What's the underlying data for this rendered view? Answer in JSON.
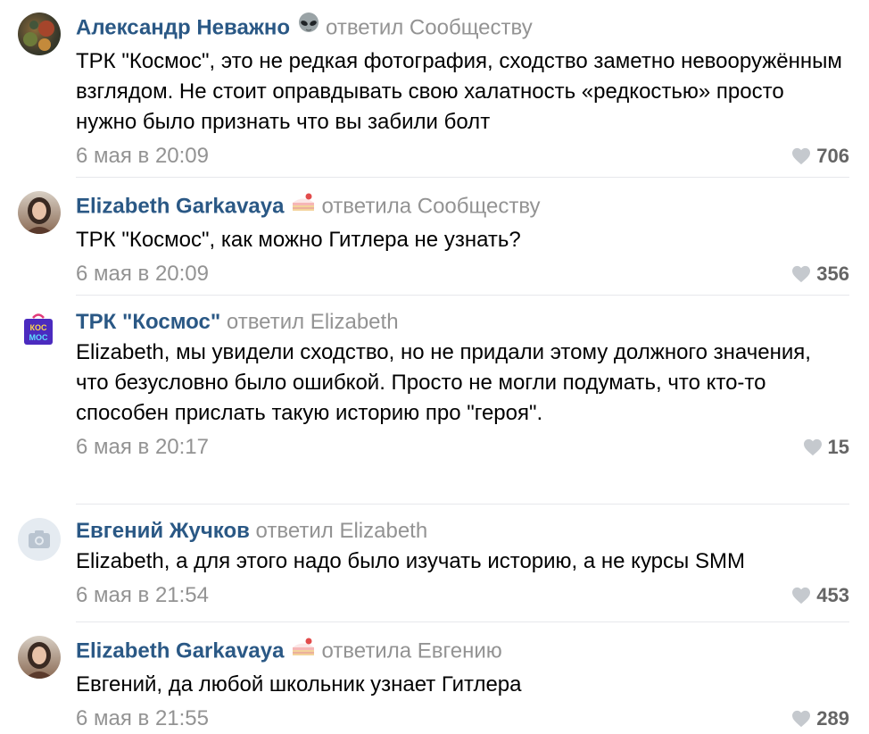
{
  "comments": [
    {
      "author": "Александр Неважно",
      "emoji": "alien-icon",
      "action": "ответил Сообществу",
      "text": "ТРК \"Космос\", это не редкая фотография, сходство заметно невооружённым взглядом. Не стоит оправдывать свою халатность «редкостью» просто нужно было признать что вы забили болт",
      "date": "6 мая в 20:09",
      "likes": "706"
    },
    {
      "author": "Elizabeth Garkavaya",
      "emoji": "cake-icon",
      "action": "ответила Сообществу",
      "text": "ТРК \"Космос\", как можно Гитлера не узнать?",
      "date": "6 мая в 20:09",
      "likes": "356"
    },
    {
      "author": "ТРК \"Космос\"",
      "emoji": "",
      "action": "ответил Elizabeth",
      "text": "Elizabeth, мы увидели сходство, но не придали этому должного значения, что безусловно было ошибкой. Просто не могли подумать, что кто-то способен прислать такую историю про \"героя\".",
      "date": "6 мая в 20:17",
      "likes": "15",
      "logo_text": "КОС МОС"
    },
    {
      "author": "Евгений Жучков",
      "emoji": "",
      "action": "ответил Elizabeth",
      "text": "Elizabeth, а для этого надо было изучать историю, а не курсы SMM",
      "date": "6 мая в 21:54",
      "likes": "453"
    },
    {
      "author": "Elizabeth Garkavaya",
      "emoji": "cake-icon",
      "action": "ответила Евгению",
      "text": "Евгений, да любой школьник узнает Гитлера",
      "date": "6 мая в 21:55",
      "likes": "289"
    }
  ],
  "colors": {
    "author": "#2a5885",
    "muted": "#939393",
    "likes": "#656565",
    "divider": "#e7e8ec"
  }
}
